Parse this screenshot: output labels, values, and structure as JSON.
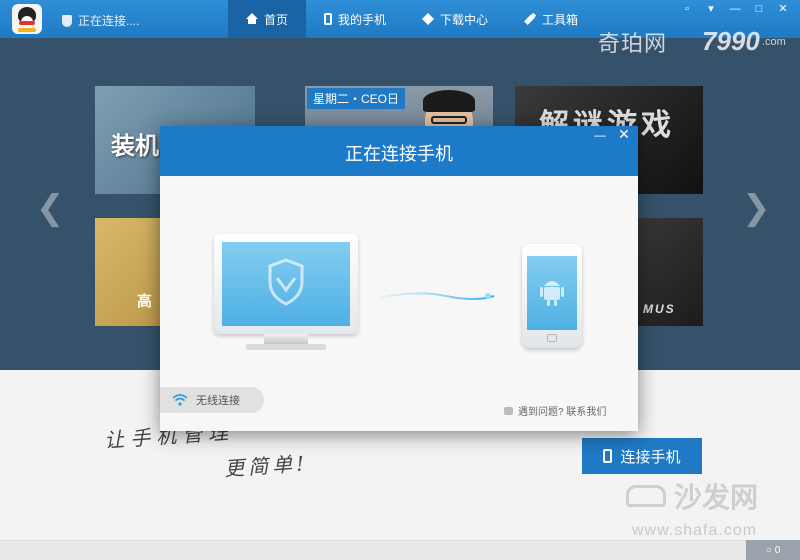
{
  "topbar": {
    "status_text": "正在连接....",
    "tabs": [
      {
        "label": "首页",
        "icon": "home-icon",
        "active": true
      },
      {
        "label": "我的手机",
        "icon": "phone-icon",
        "active": false
      },
      {
        "label": "下载中心",
        "icon": "download-icon",
        "active": false
      },
      {
        "label": "工具箱",
        "icon": "tool-icon",
        "active": false
      }
    ],
    "window_controls": [
      "menu",
      "skin",
      "minimize",
      "maximize",
      "close"
    ]
  },
  "watermarks": {
    "qipa": "奇珀网",
    "site_num": "7990",
    "site_com": ".com",
    "shafa_cn": "沙发网",
    "shafa_url": "www.shafa.com"
  },
  "banner": {
    "tile1_text": "装机",
    "tile2_tag": "星期二・CEO日",
    "tile3_text": "解谜游戏",
    "tile4_text": "高",
    "tile6_text": "MUS"
  },
  "dialog": {
    "title": "正在连接手机",
    "wifi_label": "无线连接",
    "help_text": "遇到问题? 联系我们"
  },
  "main": {
    "slogan_line1": "让手机管理",
    "slogan_line2": "更简单!",
    "connect_button": "连接手机",
    "badge_count": "0"
  },
  "colors": {
    "brand_blue": "#1d7ac9",
    "banner_bg": "#35526a",
    "screen_blue": "#4eb0e3"
  }
}
